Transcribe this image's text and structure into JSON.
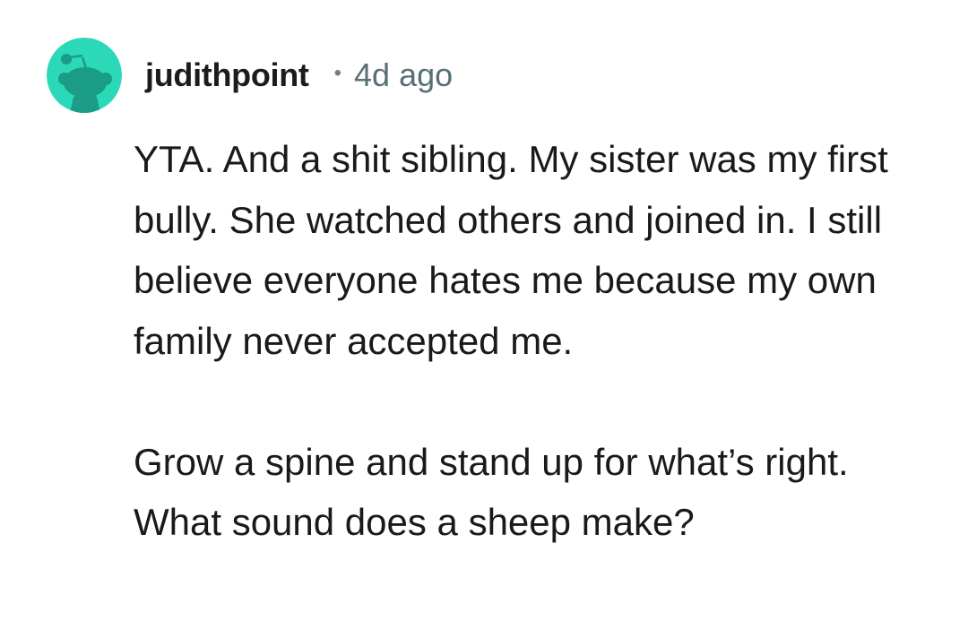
{
  "comment": {
    "username": "judithpoint",
    "separator": "•",
    "time_ago": "4d ago",
    "avatar_icon": "snoo-avatar-icon",
    "avatar_color": "#2bd9b8",
    "paragraphs": [
      "YTA. And a shit sibling. My sister was my first bully. She watched others and joined in. I still believe everyone hates me because my own family never accepted me.",
      "Grow a spine and stand up for what’s right. What sound does a sheep make?"
    ]
  }
}
